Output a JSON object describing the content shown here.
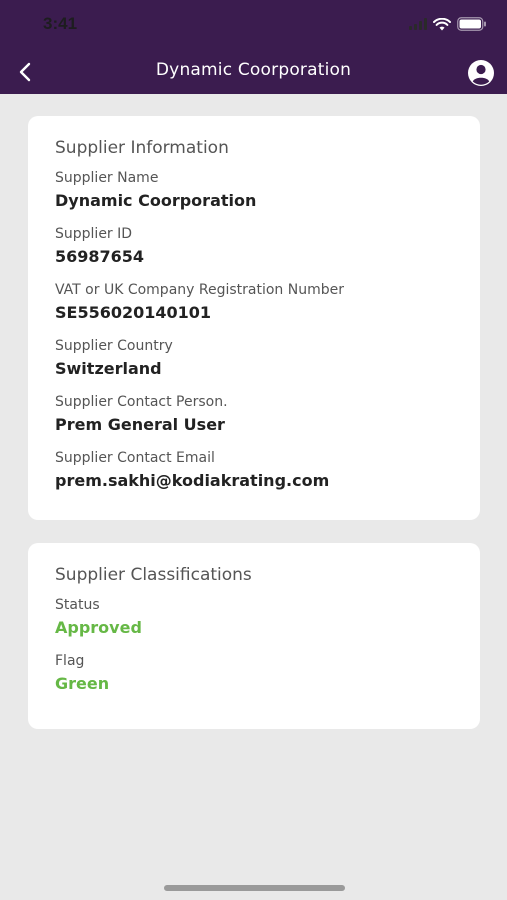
{
  "status_bar": {
    "time": "3:41"
  },
  "nav": {
    "title": "Dynamic Coorporation",
    "back_icon": "chevron-left-icon",
    "profile_icon": "user-circle-icon"
  },
  "supplier_info": {
    "title": "Supplier Information",
    "fields": [
      {
        "label": "Supplier Name",
        "value": "Dynamic Coorporation"
      },
      {
        "label": "Supplier ID",
        "value": "56987654"
      },
      {
        "label": "VAT or UK Company Registration Number",
        "value": "SE556020140101"
      },
      {
        "label": "Supplier Country",
        "value": "Switzerland"
      },
      {
        "label": "Supplier Contact Person.",
        "value": "Prem General User"
      },
      {
        "label": "Supplier Contact Email",
        "value": "prem.sakhi@kodiakrating.com"
      }
    ]
  },
  "classifications": {
    "title": "Supplier Classifications",
    "fields": [
      {
        "label": "Status",
        "value": "Approved"
      },
      {
        "label": "Flag",
        "value": "Green"
      }
    ]
  },
  "colors": {
    "header_bg": "#3b1c4f",
    "accent_green": "#66b846",
    "page_bg": "#e9e9e9"
  }
}
